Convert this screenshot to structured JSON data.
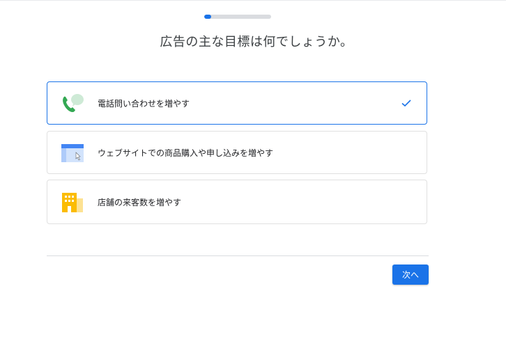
{
  "progress": {
    "fraction": 0.1
  },
  "title": "広告の主な目標は何でしょうか。",
  "options": [
    {
      "label": "電話問い合わせを増やす",
      "icon": "phone-chat-icon",
      "selected": true
    },
    {
      "label": "ウェブサイトでの商品購入や申し込みを増やす",
      "icon": "website-icon",
      "selected": false
    },
    {
      "label": "店舗の来客数を増やす",
      "icon": "store-building-icon",
      "selected": false
    }
  ],
  "next_button": {
    "label": "次へ"
  },
  "colors": {
    "accent": "#1a73e8",
    "phone_green": "#34a853",
    "chat_bubble": "#ceead6",
    "website_blue": "#4285f4",
    "website_light": "#d2e3fc",
    "store_yellow": "#fbbc04",
    "store_light": "#fde293"
  }
}
